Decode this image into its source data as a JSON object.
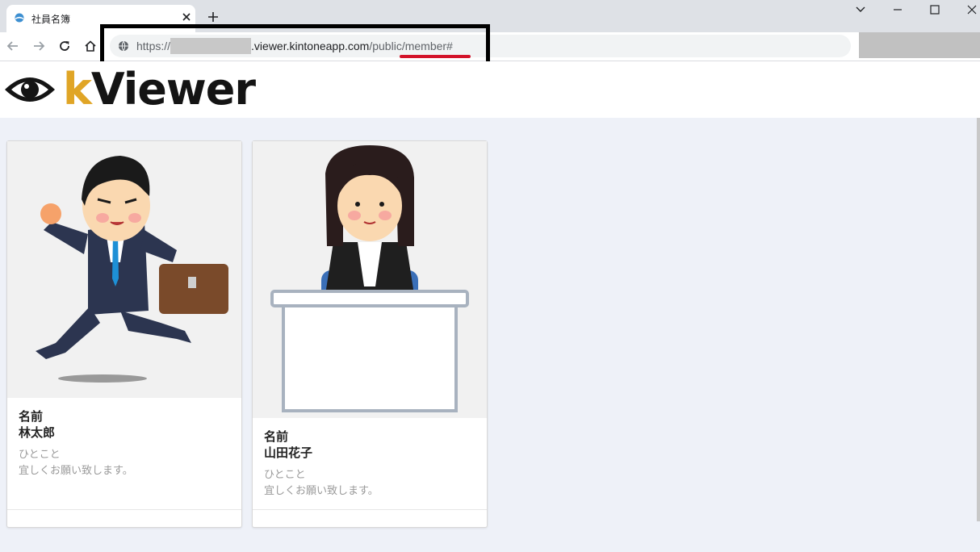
{
  "browser": {
    "tab_title": "社員名簿",
    "url_scheme": "https://",
    "url_domain": ".viewer.kintoneapp.com",
    "url_path": "/public/member#"
  },
  "app": {
    "logo_k": "k",
    "logo_rest": "Viewer"
  },
  "cards": [
    {
      "label": "名前",
      "name": "林太郎",
      "sub_label": "ひとこと",
      "message": "宜しくお願い致します。"
    },
    {
      "label": "名前",
      "name": "山田花子",
      "sub_label": "ひとこと",
      "message": "宜しくお願い致します。"
    }
  ],
  "colors": {
    "logo_accent": "#e0a526",
    "annotation_box": "#000000",
    "annotation_underline": "#d3132a"
  },
  "icons": [
    "tab-favicon-icon",
    "close-icon",
    "plus-icon",
    "chevron-down-icon",
    "minimize-icon",
    "maximize-icon",
    "window-close-icon",
    "back-arrow-icon",
    "forward-arrow-icon",
    "reload-icon",
    "home-icon",
    "globe-icon",
    "eye-icon"
  ]
}
